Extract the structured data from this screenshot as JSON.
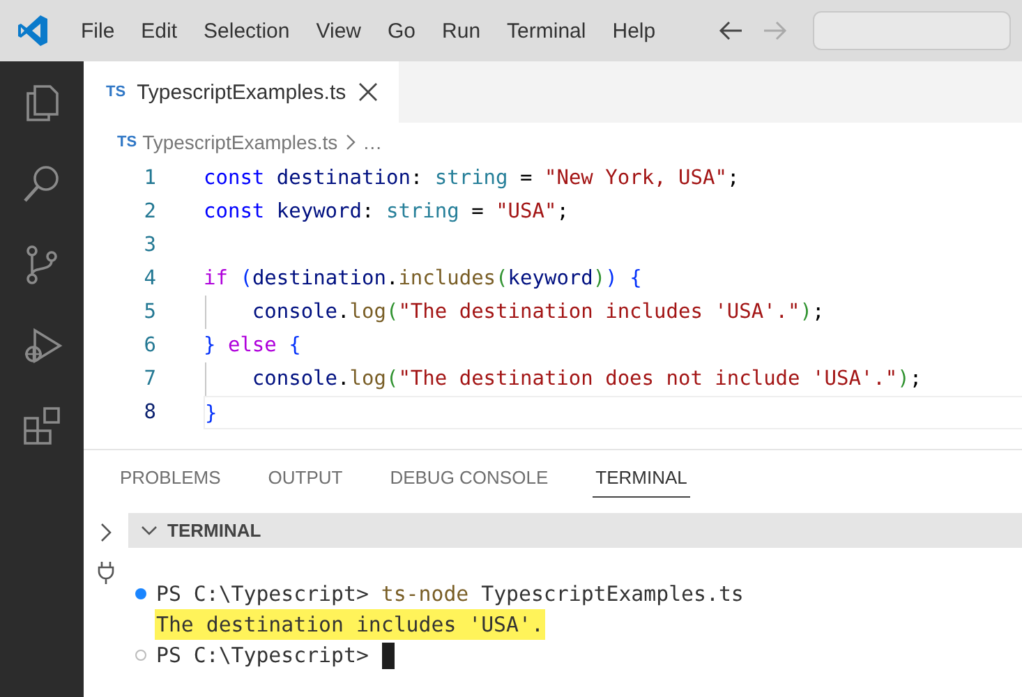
{
  "menu_bar": {
    "items": [
      "File",
      "Edit",
      "Selection",
      "View",
      "Go",
      "Run",
      "Terminal",
      "Help"
    ]
  },
  "editor": {
    "tab": {
      "icon_label": "TS",
      "title": "TypescriptExamples.ts",
      "selected": true
    },
    "breadcrumb": {
      "icon_label": "TS",
      "file": "TypescriptExamples.ts",
      "more": "…"
    },
    "lines": [
      {
        "number": "1",
        "current": false,
        "guide": false,
        "tokens": [
          {
            "text": "const ",
            "kind": "keyword"
          },
          {
            "text": "destination",
            "kind": "variable"
          },
          {
            "text": ": ",
            "kind": "punct"
          },
          {
            "text": "string",
            "kind": "type"
          },
          {
            "text": " = ",
            "kind": "punct"
          },
          {
            "text": "\"New York, USA\"",
            "kind": "string"
          },
          {
            "text": ";",
            "kind": "punct"
          }
        ]
      },
      {
        "number": "2",
        "current": false,
        "guide": false,
        "tokens": [
          {
            "text": "const ",
            "kind": "keyword"
          },
          {
            "text": "keyword",
            "kind": "variable"
          },
          {
            "text": ": ",
            "kind": "punct"
          },
          {
            "text": "string",
            "kind": "type"
          },
          {
            "text": " = ",
            "kind": "punct"
          },
          {
            "text": "\"USA\"",
            "kind": "string"
          },
          {
            "text": ";",
            "kind": "punct"
          }
        ]
      },
      {
        "number": "3",
        "current": false,
        "guide": false
      },
      {
        "number": "4",
        "current": false,
        "guide": false,
        "tokens": [
          {
            "text": "if ",
            "kind": "control"
          },
          {
            "text": "(",
            "kind": "bracket1"
          },
          {
            "text": "destination",
            "kind": "variable"
          },
          {
            "text": ".",
            "kind": "punct"
          },
          {
            "text": "includes",
            "kind": "function"
          },
          {
            "text": "(",
            "kind": "bracket2"
          },
          {
            "text": "keyword",
            "kind": "variable"
          },
          {
            "text": ")",
            "kind": "bracket2"
          },
          {
            "text": ") {",
            "kind": "bracket1"
          }
        ]
      },
      {
        "number": "5",
        "current": false,
        "guide": true,
        "tokens": [
          {
            "text": "console",
            "kind": "variable"
          },
          {
            "text": ".",
            "kind": "punct"
          },
          {
            "text": "log",
            "kind": "function"
          },
          {
            "text": "(",
            "kind": "bracket2"
          },
          {
            "text": "\"The destination includes 'USA'.\"",
            "kind": "string"
          },
          {
            "text": ")",
            "kind": "bracket2"
          },
          {
            "text": ";",
            "kind": "punct"
          }
        ]
      },
      {
        "number": "6",
        "current": false,
        "guide": false,
        "tokens": [
          {
            "text": "} ",
            "kind": "bracket1"
          },
          {
            "text": "else ",
            "kind": "control"
          },
          {
            "text": "{",
            "kind": "bracket1"
          }
        ]
      },
      {
        "number": "7",
        "current": false,
        "guide": true,
        "tokens": [
          {
            "text": "console",
            "kind": "variable"
          },
          {
            "text": ".",
            "kind": "punct"
          },
          {
            "text": "log",
            "kind": "function"
          },
          {
            "text": "(",
            "kind": "bracket2"
          },
          {
            "text": "\"The destination does not include 'USA'.\"",
            "kind": "string"
          },
          {
            "text": ")",
            "kind": "bracket2"
          },
          {
            "text": ";",
            "kind": "punct"
          }
        ]
      },
      {
        "number": "8",
        "current": true,
        "guide": false,
        "tokens": [
          {
            "text": "}",
            "kind": "bracket1"
          }
        ]
      }
    ]
  },
  "panel": {
    "tabs": [
      {
        "label": "PROBLEMS",
        "selected": false
      },
      {
        "label": "OUTPUT",
        "selected": false
      },
      {
        "label": "DEBUG CONSOLE",
        "selected": false
      },
      {
        "label": "TERMINAL",
        "selected": true
      }
    ],
    "terminal_header": "TERMINAL",
    "terminal_lines": [
      {
        "kind": "success",
        "highlighted": false,
        "cursor": false,
        "segments": [
          {
            "text": "PS C:\\Typescript> ",
            "kind": "plain"
          },
          {
            "text": "ts-node",
            "kind": "command"
          },
          {
            "text": " TypescriptExamples.ts",
            "kind": "plain"
          }
        ]
      },
      {
        "kind": "output",
        "highlighted": true,
        "cursor": false,
        "segments": [
          {
            "text": "The destination includes 'USA'.",
            "kind": "plain"
          }
        ]
      },
      {
        "kind": "idle",
        "highlighted": false,
        "cursor": true,
        "segments": [
          {
            "text": "PS C:\\Typescript> ",
            "kind": "plain"
          }
        ]
      }
    ]
  }
}
